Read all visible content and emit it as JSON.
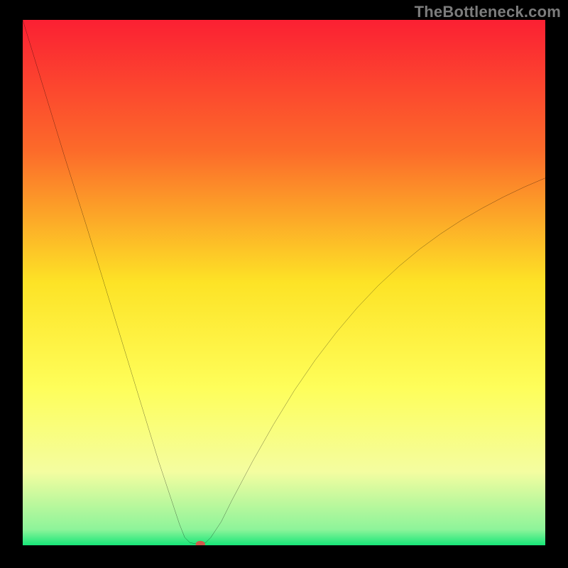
{
  "watermark": "TheBottleneck.com",
  "chart_data": {
    "type": "line",
    "title": "",
    "xlabel": "",
    "ylabel": "",
    "xlim": [
      0,
      100
    ],
    "ylim": [
      0,
      100
    ],
    "grid": false,
    "legend": false,
    "annotations": [],
    "background_gradient_stops": [
      {
        "pct": 0,
        "color": "#fb2033"
      },
      {
        "pct": 25,
        "color": "#fc6b2a"
      },
      {
        "pct": 50,
        "color": "#fde326"
      },
      {
        "pct": 70,
        "color": "#fefe5a"
      },
      {
        "pct": 86,
        "color": "#f4fda0"
      },
      {
        "pct": 97,
        "color": "#8df49a"
      },
      {
        "pct": 100,
        "color": "#17e678"
      }
    ],
    "curve": {
      "name": "bottleneck-v-curve",
      "description": "V-shaped curve: steep near-linear descent on left, near-zero flat minimum segment, then decelerating rise on right.",
      "x": [
        0,
        2,
        4,
        6,
        8,
        10,
        12,
        14,
        16,
        18,
        20,
        22,
        24,
        26,
        28,
        30,
        31,
        32,
        33,
        34,
        35,
        36,
        38,
        40,
        44,
        48,
        52,
        56,
        60,
        64,
        68,
        72,
        76,
        80,
        84,
        88,
        92,
        96,
        100
      ],
      "y": [
        100,
        93.5,
        87,
        80.5,
        74,
        67.7,
        61.4,
        55,
        48.5,
        42,
        35.5,
        29,
        22.5,
        16,
        10,
        4,
        1.5,
        0.5,
        0.3,
        0.3,
        0.5,
        1.5,
        4.5,
        8.5,
        16,
        23,
        29.5,
        35.3,
        40.5,
        45.2,
        49.4,
        53.1,
        56.4,
        59.3,
        61.9,
        64.2,
        66.3,
        68.2,
        69.9
      ]
    },
    "marker": {
      "name": "min-marker",
      "x": 34,
      "y": 0.2,
      "rx": 0.9,
      "ry": 0.65,
      "color": "#d15a4c"
    }
  }
}
